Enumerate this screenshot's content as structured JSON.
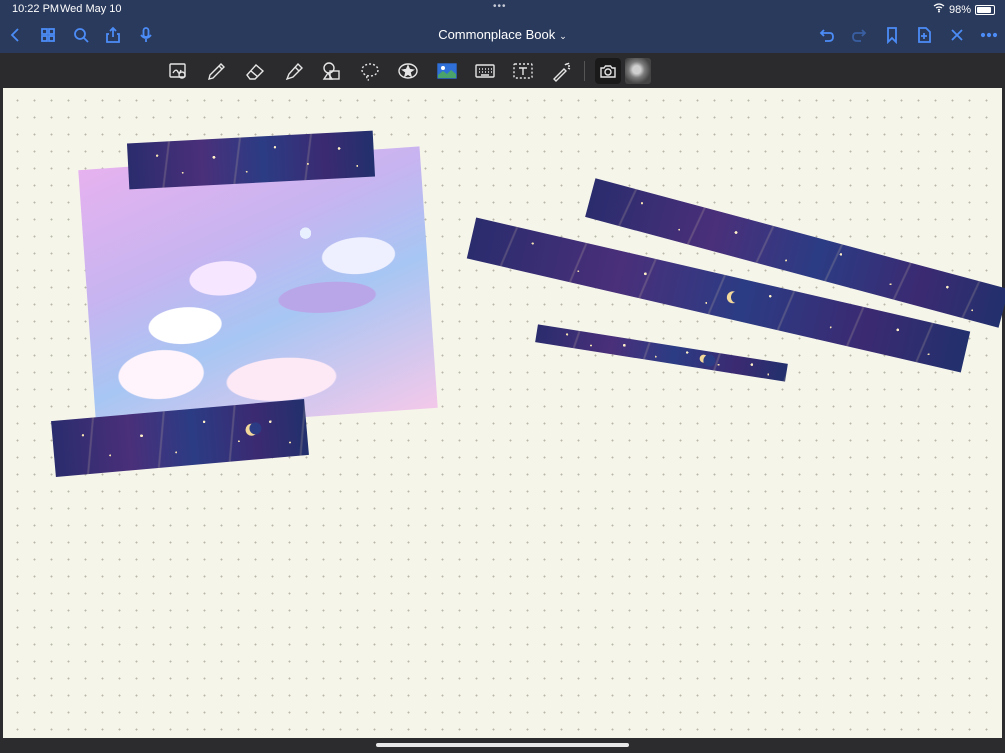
{
  "status_bar": {
    "time": "10:22 PM",
    "date": "Wed May 10",
    "battery": "98%"
  },
  "nav_bar": {
    "title": "Commonplace Book",
    "left_icons": [
      "back-icon",
      "grid-icon",
      "search-icon",
      "share-icon",
      "microphone-icon"
    ],
    "right_icons": [
      "undo-icon",
      "redo-icon",
      "bookmark-icon",
      "add-page-icon",
      "close-icon",
      "more-icon"
    ]
  },
  "toolbar": {
    "tools": [
      "zoom-window-icon",
      "pen-icon",
      "eraser-icon",
      "highlighter-icon",
      "shapes-icon",
      "lasso-icon",
      "elements-icon",
      "image-icon",
      "keyboard-icon",
      "text-box-icon",
      "laser-pointer-icon",
      "camera-icon",
      "photo-thumbnail"
    ]
  },
  "colors": {
    "accent": "#4c8cf7",
    "nav_bg": "#2a3a5c",
    "toolbar_bg": "#2b2b2d",
    "paper": "#f6f5ea"
  }
}
